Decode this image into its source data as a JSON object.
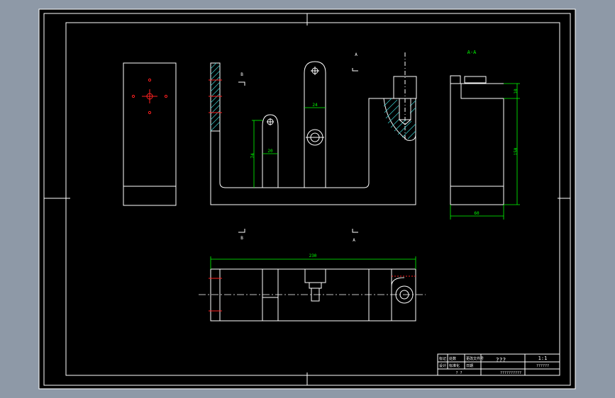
{
  "colors": {
    "workspace": "#8e99a7",
    "sheet": "#000000",
    "line": "#ffffff",
    "dimension": "#00ff00",
    "hole": "#ff2020",
    "hatch": "#38c8c8"
  },
  "section_labels": {
    "A_top": "A",
    "A_bottom": "A",
    "B_top": "B",
    "B_bottom": "B",
    "aa_title": "A-A"
  },
  "dimensions": {
    "slot_width": "24",
    "tab_width": "20",
    "tab_height": "74",
    "side_top": "10",
    "side_height": "150",
    "side_width": "60",
    "total_length": "230"
  },
  "title_block": {
    "cell_1": "标记",
    "cell_2": "处数",
    "cell_3": "更改文件号",
    "cell_4": "签字",
    "cell_5": "日期",
    "cell_6": "设计",
    "cell_7": "标准化",
    "cell_8": "1:1",
    "name": "???",
    "sheet_no": "1:1",
    "drawing_no": "??????",
    "bottom_left": "? ?",
    "bottom_mid": "??????????"
  }
}
